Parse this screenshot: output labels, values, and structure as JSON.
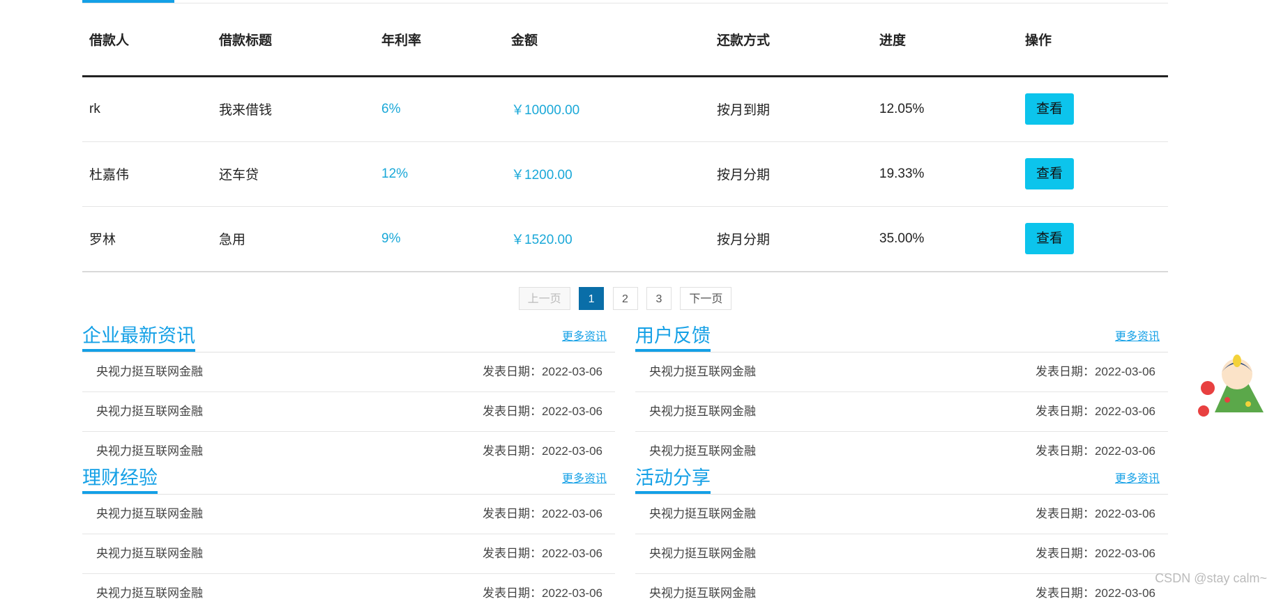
{
  "table": {
    "headers": [
      "借款人",
      "借款标题",
      "年利率",
      "金额",
      "还款方式",
      "进度",
      "操作"
    ],
    "rows": [
      {
        "borrower": "rk",
        "title": "我来借钱",
        "rate": "6%",
        "amount": "￥10000.00",
        "method": "按月到期",
        "progress": "12.05%",
        "action": "查看"
      },
      {
        "borrower": "杜嘉伟",
        "title": "还车贷",
        "rate": "12%",
        "amount": "￥1200.00",
        "method": "按月分期",
        "progress": "19.33%",
        "action": "查看"
      },
      {
        "borrower": "罗林",
        "title": "急用",
        "rate": "9%",
        "amount": "￥1520.00",
        "method": "按月分期",
        "progress": "35.00%",
        "action": "查看"
      }
    ]
  },
  "pager": {
    "prev": "上一页",
    "pages": [
      "1",
      "2",
      "3"
    ],
    "current": "1",
    "next": "下一页"
  },
  "panels": [
    {
      "title": "企业最新资讯",
      "more": "更多资讯",
      "items": [
        {
          "text": "央视力挺互联网金融",
          "date": "发表日期：2022-03-06"
        },
        {
          "text": "央视力挺互联网金融",
          "date": "发表日期：2022-03-06"
        },
        {
          "text": "央视力挺互联网金融",
          "date": "发表日期：2022-03-06"
        }
      ]
    },
    {
      "title": "用户反馈",
      "more": "更多资讯",
      "items": [
        {
          "text": "央视力挺互联网金融",
          "date": "发表日期：2022-03-06"
        },
        {
          "text": "央视力挺互联网金融",
          "date": "发表日期：2022-03-06"
        },
        {
          "text": "央视力挺互联网金融",
          "date": "发表日期：2022-03-06"
        }
      ]
    },
    {
      "title": "理财经验",
      "more": "更多资讯",
      "items": [
        {
          "text": "央视力挺互联网金融",
          "date": "发表日期：2022-03-06"
        },
        {
          "text": "央视力挺互联网金融",
          "date": "发表日期：2022-03-06"
        },
        {
          "text": "央视力挺互联网金融",
          "date": "发表日期：2022-03-06"
        }
      ]
    },
    {
      "title": "活动分享",
      "more": "更多资讯",
      "items": [
        {
          "text": "央视力挺互联网金融",
          "date": "发表日期：2022-03-06"
        },
        {
          "text": "央视力挺互联网金融",
          "date": "发表日期：2022-03-06"
        },
        {
          "text": "央视力挺互联网金融",
          "date": "发表日期：2022-03-06"
        }
      ]
    }
  ],
  "watermark": "CSDN @stay calm~",
  "colors": {
    "accent": "#14a0e6",
    "button": "#0cc4ec",
    "pager_current": "#0a6ea8"
  }
}
